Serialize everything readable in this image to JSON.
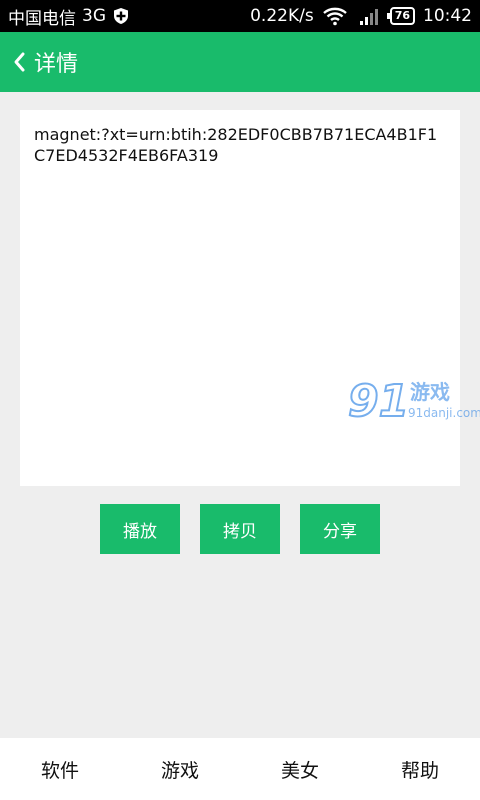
{
  "status_bar": {
    "carrier": "中国电信",
    "network": "3G",
    "speed": "0.22K/s",
    "battery": "76",
    "time": "10:42",
    "icons": [
      "shield-icon",
      "wifi-icon",
      "signal-icon",
      "battery-icon"
    ]
  },
  "header": {
    "back_icon": "chevron-left-icon",
    "title": "详情"
  },
  "content": {
    "magnet_link": "magnet:?xt=urn:btih:282EDF0CBB7B71ECA4B1F1C7ED4532F4EB6FA319"
  },
  "watermark": {
    "logo": "91",
    "text": "游戏",
    "site": "91danji.com"
  },
  "actions": {
    "play_label": "播放",
    "copy_label": "拷贝",
    "share_label": "分享"
  },
  "bottom_nav": {
    "items": [
      {
        "label": "软件"
      },
      {
        "label": "游戏"
      },
      {
        "label": "美女"
      },
      {
        "label": "帮助"
      }
    ]
  },
  "colors": {
    "accent": "#19bb6b",
    "background": "#eeeeee",
    "status_bar": "#000000"
  }
}
